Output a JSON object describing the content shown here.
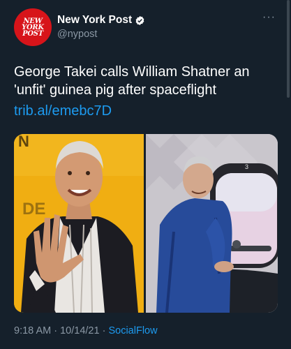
{
  "account": {
    "avatar_text": "NEW\nYORK\nPOST",
    "display_name": "New York Post",
    "handle": "@nypost",
    "verified": true
  },
  "more_icon": "···",
  "tweet": {
    "text": "George Takei calls William Shatner an 'unfit' guinea pig after spaceflight",
    "link": "trib.al/emebc7D"
  },
  "media": {
    "left_backdrop_text": "N\nDE",
    "right_window_number": "3"
  },
  "meta": {
    "time": "9:18 AM",
    "date": "10/14/21",
    "separator": "·",
    "source": "SocialFlow"
  },
  "colors": {
    "background": "#15202b",
    "link": "#1d9bf0",
    "secondary_text": "#8b98a5",
    "avatar": "#d7141a"
  }
}
